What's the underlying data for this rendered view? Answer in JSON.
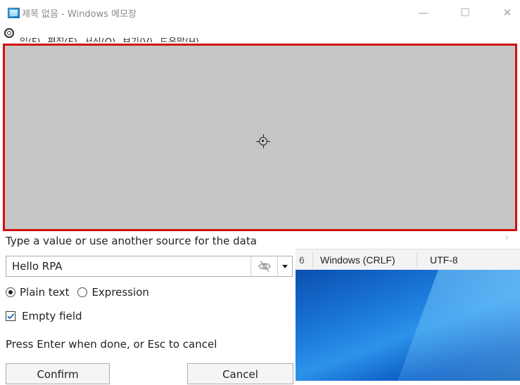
{
  "window": {
    "title": "제목 없음 - Windows 메모장",
    "minimize_glyph": "—",
    "maximize_glyph": "☐",
    "close_glyph": "✕"
  },
  "menu": {
    "items": [
      {
        "label": "일(F)"
      },
      {
        "label": "편집(E)"
      },
      {
        "label": "서식(O)"
      },
      {
        "label": "보기(V)"
      },
      {
        "label": "도움말(H)"
      }
    ]
  },
  "statusbar": {
    "zoom_fragment": "6",
    "line_ending": "Windows (CRLF)",
    "encoding": "UTF-8",
    "scroll_right_glyph": "›"
  },
  "popup": {
    "hint": "Type a value or use another source for the data",
    "value": "Hello RPA",
    "mode_options": [
      {
        "label": "Plain text",
        "selected": true
      },
      {
        "label": "Expression",
        "selected": false
      }
    ],
    "empty_field_label": "Empty field",
    "empty_field_checked": true,
    "help": "Press Enter when done, or Esc to cancel",
    "confirm_label": "Confirm",
    "cancel_label": "Cancel"
  },
  "colors": {
    "highlight_border": "#d21010",
    "edit_area_fill": "#c6c6c6"
  }
}
